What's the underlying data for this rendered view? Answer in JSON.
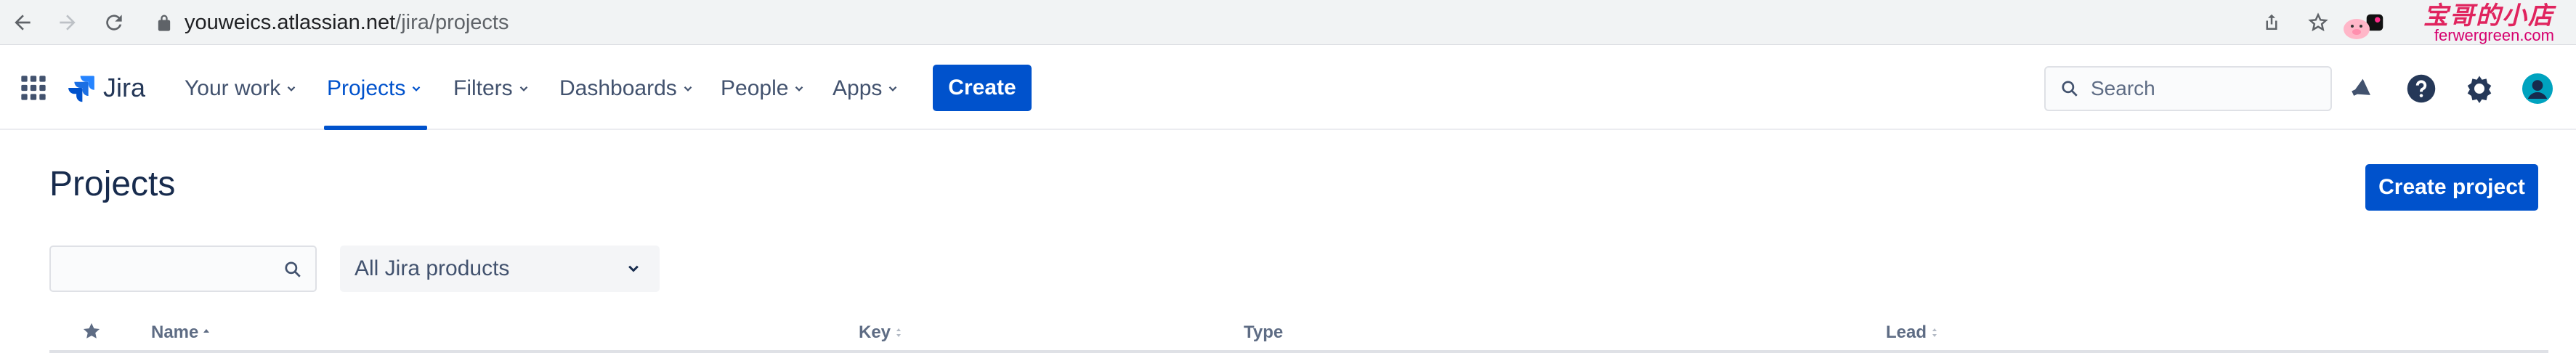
{
  "browser": {
    "url_host": "youweics.atlassian.net",
    "url_path": "/jira/projects"
  },
  "watermark": {
    "title": "宝哥的小店",
    "url": "ferwergreen.com"
  },
  "nav": {
    "product": "Jira",
    "items": [
      {
        "label": "Your work"
      },
      {
        "label": "Projects"
      },
      {
        "label": "Filters"
      },
      {
        "label": "Dashboards"
      },
      {
        "label": "People"
      },
      {
        "label": "Apps"
      }
    ],
    "active": "Projects",
    "create_label": "Create",
    "search_placeholder": "Search"
  },
  "page": {
    "title": "Projects",
    "create_project_label": "Create project",
    "filter_input_value": "",
    "product_filter_selected": "All Jira products"
  },
  "table": {
    "columns": [
      {
        "key": "starred",
        "label": ""
      },
      {
        "key": "name",
        "label": "Name",
        "sort": "ascending"
      },
      {
        "key": "key",
        "label": "Key",
        "sort": "none"
      },
      {
        "key": "type",
        "label": "Type"
      },
      {
        "key": "lead",
        "label": "Lead",
        "sort": "none"
      }
    ]
  },
  "colors": {
    "brand": "#0052cc",
    "text": "#172b4d",
    "muted": "#42526e"
  }
}
